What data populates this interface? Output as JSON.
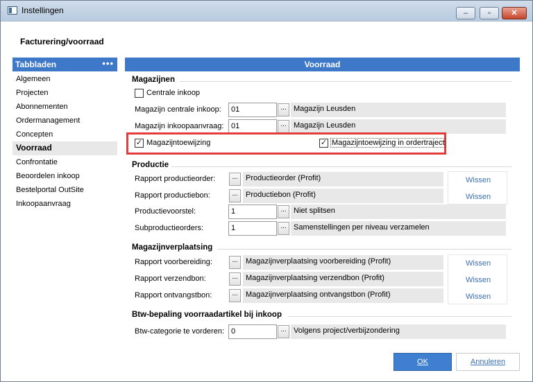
{
  "window": {
    "title": "Instellingen",
    "min": "–",
    "max": "▫",
    "close": "✕"
  },
  "page_title": "Facturering/voorraad",
  "nav": {
    "header": "Tabbladen",
    "dots": "•••",
    "items": [
      "Algemeen",
      "Projecten",
      "Abonnementen",
      "Ordermanagement",
      "Concepten",
      "Voorraad",
      "Confrontatie",
      "Beoordelen inkoop",
      "Bestelportal OutSite",
      "Inkoopaanvraag"
    ],
    "selected": "Voorraad"
  },
  "panel": {
    "header": "Voorraad",
    "magazijnen": {
      "title": "Magazijnen",
      "centrale_inkoop": {
        "label": "Centrale inkoop",
        "checked": false
      },
      "magazijn_centrale_inkoop": {
        "label": "Magazijn centrale inkoop:",
        "value": "01",
        "desc": "Magazijn Leusden"
      },
      "magazijn_inkoopaanvraag": {
        "label": "Magazijn inkoopaanvraag:",
        "value": "01",
        "desc": "Magazijn Leusden"
      },
      "magazijntoewijzing": {
        "label": "Magazijntoewijzing",
        "checked": true
      },
      "magazijntoewijzing_ordertraject": {
        "label": "Magazijntoewijzing in ordertraject",
        "checked": true
      }
    },
    "productie": {
      "title": "Productie",
      "rapport_productieorder": {
        "label": "Rapport productieorder:",
        "desc": "Productieorder (Profit)"
      },
      "rapport_productiebon": {
        "label": "Rapport productiebon:",
        "desc": "Productiebon (Profit)"
      },
      "productievoorstel": {
        "label": "Productievoorstel:",
        "value": "1",
        "desc": "Niet splitsen"
      },
      "subproductieorders": {
        "label": "Subproductieorders:",
        "value": "1",
        "desc": "Samenstellingen per niveau verzamelen"
      }
    },
    "magazijnverplaatsing": {
      "title": "Magazijnverplaatsing",
      "rapport_voorbereiding": {
        "label": "Rapport voorbereiding:",
        "desc": "Magazijnverplaatsing voorbereiding (Profit)"
      },
      "rapport_verzendbon": {
        "label": "Rapport verzendbon:",
        "desc": "Magazijnverplaatsing verzendbon (Profit)"
      },
      "rapport_ontvangstbon": {
        "label": "Rapport ontvangstbon:",
        "desc": "Magazijnverplaatsing ontvangstbon (Profit)"
      }
    },
    "btw": {
      "title": "Btw-bepaling voorraadartikel bij inkoop",
      "btw_categorie": {
        "label": "Btw-categorie te vorderen:",
        "value": "0",
        "desc": "Volgens project/verbijzondering"
      }
    },
    "wissen_label": "Wissen",
    "dots_btn": "..."
  },
  "buttons": {
    "ok": "OK",
    "cancel": "Annuleren"
  },
  "colors": {
    "accent": "#3e78c8",
    "highlight": "#e43b3b",
    "link": "#3b6fb6"
  }
}
